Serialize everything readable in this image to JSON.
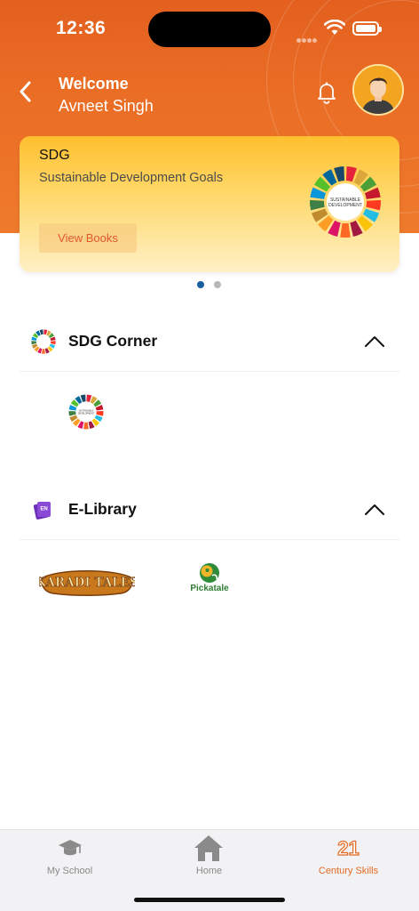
{
  "status_bar": {
    "time": "12:36"
  },
  "header": {
    "welcome": "Welcome",
    "user_name": "Avneet Singh"
  },
  "banner": {
    "title": "SDG",
    "subtitle": "Sustainable Development Goals",
    "button_label": "View Books",
    "logo_text_line1": "SUSTAINABLE",
    "logo_text_line2": "DEVELOPMENT",
    "page_count": 2,
    "active_page": 1
  },
  "sections": {
    "sdg_corner": {
      "title": "SDG Corner",
      "tile_text_1": "SUSTAINABLE",
      "tile_text_2": "DEVELOPMENT"
    },
    "elibrary": {
      "title": "E-Library",
      "icon_badge": "EN",
      "tiles": {
        "karadi": "KARADI TALES",
        "pickatale": "Pickatale"
      }
    }
  },
  "tabbar": {
    "my_school": "My School",
    "home": "Home",
    "century_skills": "Century Skills",
    "century_skills_glyph": "21",
    "active": "Century Skills"
  },
  "colors": {
    "header_orange": "#e3601f",
    "accent": "#e36a24",
    "dot_active": "#1a5ea0",
    "banner_yellow": "#ffbf2e"
  }
}
